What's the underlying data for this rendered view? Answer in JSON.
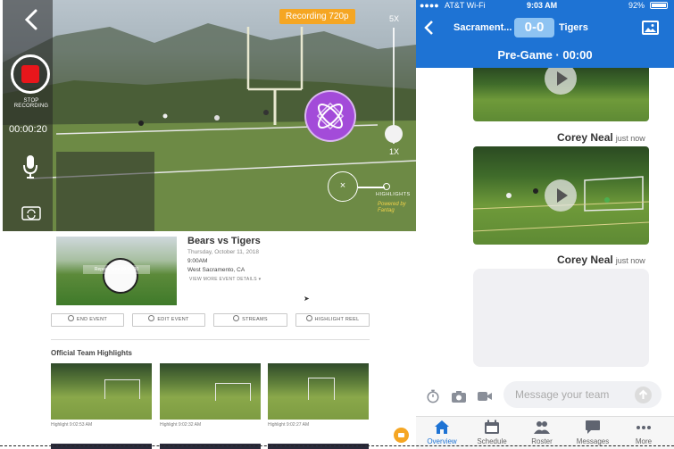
{
  "recorder": {
    "stop_label": "STOP RECORDING",
    "timer": "00:00:20",
    "recording_badge": "Recording 720p",
    "zoom_max": "5X",
    "zoom_min": "1X",
    "highlights_label": "HIGHLIGHTS",
    "powered_by": "Powered by",
    "brand": "Fantag",
    "highlight_symbol": "×"
  },
  "event": {
    "title": "Bears vs Tigers",
    "date": "Thursday, October 11, 2018",
    "time": "9:00AM",
    "location": "West Sacramento, CA",
    "more_details": "VIEW MORE EVENT DETAILS ▾",
    "thumb_banner": "Repeat Time 00:00:00",
    "actions": [
      "END EVENT",
      "EDIT EVENT",
      "STREAMS",
      "HIGHLIGHT REEL"
    ]
  },
  "highlights": {
    "title": "Official Team Highlights",
    "items": [
      {
        "caption": "Highlight 9:02:53 AM"
      },
      {
        "caption": "Highlight 9:02:32 AM"
      },
      {
        "caption": "Highlight 9:02:27 AM"
      }
    ]
  },
  "phone": {
    "carrier": "AT&T Wi-Fi",
    "clock": "9:03 AM",
    "battery": "92%",
    "team_a": "Sacrament...",
    "score": "0-0",
    "team_b": "Tigers",
    "game_status": "Pre-Game · 00:00",
    "messages": [
      {
        "sender": "Corey Neal",
        "time": "just now"
      },
      {
        "sender": "Corey Neal",
        "time": "just now"
      }
    ],
    "compose_placeholder": "Message your team",
    "tabs": [
      {
        "label": "Overview",
        "icon": "home-icon"
      },
      {
        "label": "Schedule",
        "icon": "calendar-icon"
      },
      {
        "label": "Roster",
        "icon": "people-icon"
      },
      {
        "label": "Messages",
        "icon": "chat-icon"
      },
      {
        "label": "More",
        "icon": "more-icon"
      }
    ]
  },
  "colors": {
    "accent_blue": "#1e73d4",
    "record_red": "#e8161b",
    "badge_orange": "#f5a623",
    "logo_purple": "#a34bd9"
  }
}
